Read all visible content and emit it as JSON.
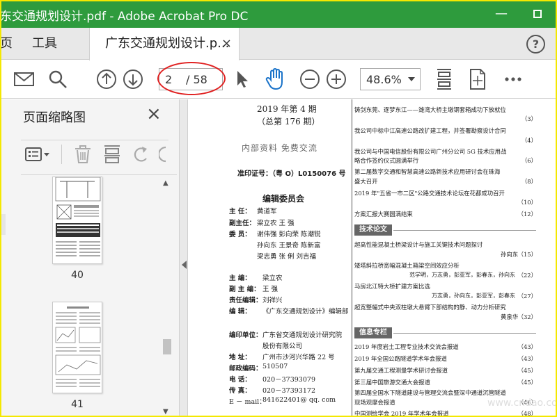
{
  "window": {
    "title": "东交通规划设计.pdf - Adobe Acrobat Pro DC",
    "minimize": "—",
    "maximize": ""
  },
  "tabs": {
    "home": "页",
    "tools": "工具",
    "document": "广东交通规划设计.p...",
    "close": "×",
    "help": "?"
  },
  "toolbar": {
    "current_page": "2",
    "total_pages": "/ 58",
    "zoom": "48.6%"
  },
  "sidebar": {
    "title": "页面缩略图",
    "close": "×",
    "thumbnails": [
      {
        "label": "40"
      },
      {
        "label": "41"
      }
    ]
  },
  "document": {
    "left": {
      "issue": "2019 年第 4 期",
      "total_issue": "（总第 176 期）",
      "internal": "内部资料    免费交流",
      "permit": "准印证号：（粤 O）L0150076 号",
      "board_title": "编辑委员会",
      "director_label": "主   任：",
      "director": "黄道军",
      "vice_label": "副主任：",
      "vice": "梁立农    王    强",
      "member_label": "委   员：",
      "members": [
        "谢伟强    彭向荣    陈潮锐",
        "孙向东    王景奇    陈新富",
        "梁志勇    张    俐    刘吉福"
      ],
      "editor_label": "主      编：",
      "editor": "梁立农",
      "vice_editor_label": "副 主 编：",
      "vice_editor": "王    强",
      "resp_editor_label": "责任编辑：",
      "resp_editor": "刘祥兴",
      "editing_label": "编      辑：",
      "editing": "《广东交通规划设计》编辑部",
      "org_label": "编印单位：",
      "org_line1": "广东省交通规划设计研究院",
      "org_line2": "股份有限公司",
      "addr_label": "地      址：",
      "addr": "广州市沙河兴华路 22 号",
      "zip_label": "邮政编码：",
      "zip": "510507",
      "tel_label": "电      话：",
      "tel": "020－37393079",
      "fax_label": "传      真：",
      "fax": "020－37393172",
      "email_label": "E － mail：",
      "email": "841622401@ qq. com"
    },
    "right": {
      "items": [
        {
          "text": "铸剑东莞、逐梦东江——潍湾大桥主墩钢套箱成功下放就位",
          "page": ""
        },
        {
          "text": "",
          "page": "（3）"
        },
        {
          "text": "我公司中标中江高速公路改扩建工程，并签署勘察设计合同",
          "page": ""
        },
        {
          "text": "",
          "page": "（4）"
        },
        {
          "text": "我公司与中国电信股份有限公司广州分公司 5G 技术应用战",
          "page": ""
        },
        {
          "text": "略合作签约仪式圆满举行",
          "page": "（6）"
        },
        {
          "text": "第二届数字交通和智慧高速公路新技术应用研讨会在珠海",
          "page": ""
        },
        {
          "text": "盛大召开",
          "page": "（8）"
        },
        {
          "text": "2019 年\"五省一市二区\"公路交通技术论坛在花都成功召开",
          "page": ""
        },
        {
          "text": "",
          "page": "（10）"
        },
        {
          "text": "方案汇报大赛圆满结束",
          "page": "（12）"
        }
      ],
      "section1": "技术论文",
      "papers": [
        {
          "text": "超高性能混凝土桥梁设计与施工关键技术问题探讨",
          "page": ""
        },
        {
          "text": "孙向东",
          "page": "（15）"
        },
        {
          "text": "矮塔斜拉桥宽幅混凝土箱梁空间效应分析",
          "page": ""
        },
        {
          "text": "范学明，万志勇，彭亚军，彭春东，孙向东",
          "page": "（22）"
        },
        {
          "text": "马房北江特大桥扩建方案比选",
          "page": ""
        },
        {
          "text": "万志勇，孙向东，彭亚军，彭春东",
          "page": "（27）"
        },
        {
          "text": "超宽整幅式中央双柱墩大悬臂下部结构的静、动力分析研究",
          "page": ""
        },
        {
          "text": "黄泉华",
          "page": "（32）"
        }
      ],
      "section2": "信息专栏",
      "info": [
        {
          "text": "2019 年度岩土工程专业技术交流会报道",
          "page": "（43）"
        },
        {
          "text": "2019 年全国公路隧道学术年会报道",
          "page": "（43）"
        },
        {
          "text": "第九届交通工程测量学术研讨会报道",
          "page": "（45）"
        },
        {
          "text": "第三届中国旅游交通大会报道",
          "page": "（45）"
        },
        {
          "text": "第四届全国水下隧道建设与管理交流会暨深中通道沉管隧道",
          "page": ""
        },
        {
          "text": "现场观摩会报道",
          "page": "（46）"
        },
        {
          "text": "中国测绘学会 2019 年学术年会报道",
          "page": "（48）"
        }
      ]
    }
  },
  "watermark": "www.cndao.com"
}
